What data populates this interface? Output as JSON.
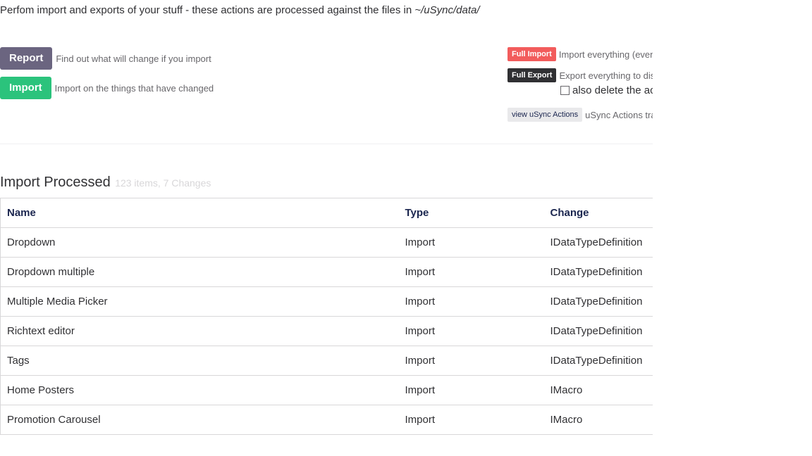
{
  "intro": {
    "text": "Perfom import and exports of your stuff - these actions are processed against the files in ",
    "path": "~/uSync/data/"
  },
  "actions": {
    "report": {
      "label": "Report",
      "description": "Find out what will change if you import"
    },
    "import": {
      "label": "Import",
      "description": "Import on the things that have changed"
    },
    "full_import": {
      "label": "Full Import",
      "description": "Import everything (even"
    },
    "full_export": {
      "label": "Full Export",
      "description": "Export everything to disl",
      "option_label": "also delete the ac",
      "option_checked": false
    },
    "view_actions": {
      "label": "view uSync Actions",
      "description": "uSync Actions tra"
    }
  },
  "results": {
    "title": "Import Processed",
    "summary": "123 items, 7 Changes",
    "columns": [
      "Name",
      "Type",
      "Change"
    ],
    "rows": [
      {
        "name": "Dropdown",
        "type": "Import",
        "change": "IDataTypeDefinition"
      },
      {
        "name": "Dropdown multiple",
        "type": "Import",
        "change": "IDataTypeDefinition"
      },
      {
        "name": "Multiple Media Picker",
        "type": "Import",
        "change": "IDataTypeDefinition"
      },
      {
        "name": "Richtext editor",
        "type": "Import",
        "change": "IDataTypeDefinition"
      },
      {
        "name": "Tags",
        "type": "Import",
        "change": "IDataTypeDefinition"
      },
      {
        "name": "Home Posters",
        "type": "Import",
        "change": "IMacro"
      },
      {
        "name": "Promotion Carousel",
        "type": "Import",
        "change": "IMacro"
      }
    ]
  },
  "colors": {
    "report_button": "#6b6580",
    "import_button": "#2bc37c",
    "full_import_button": "#f25c5c",
    "full_export_button": "#303033"
  }
}
